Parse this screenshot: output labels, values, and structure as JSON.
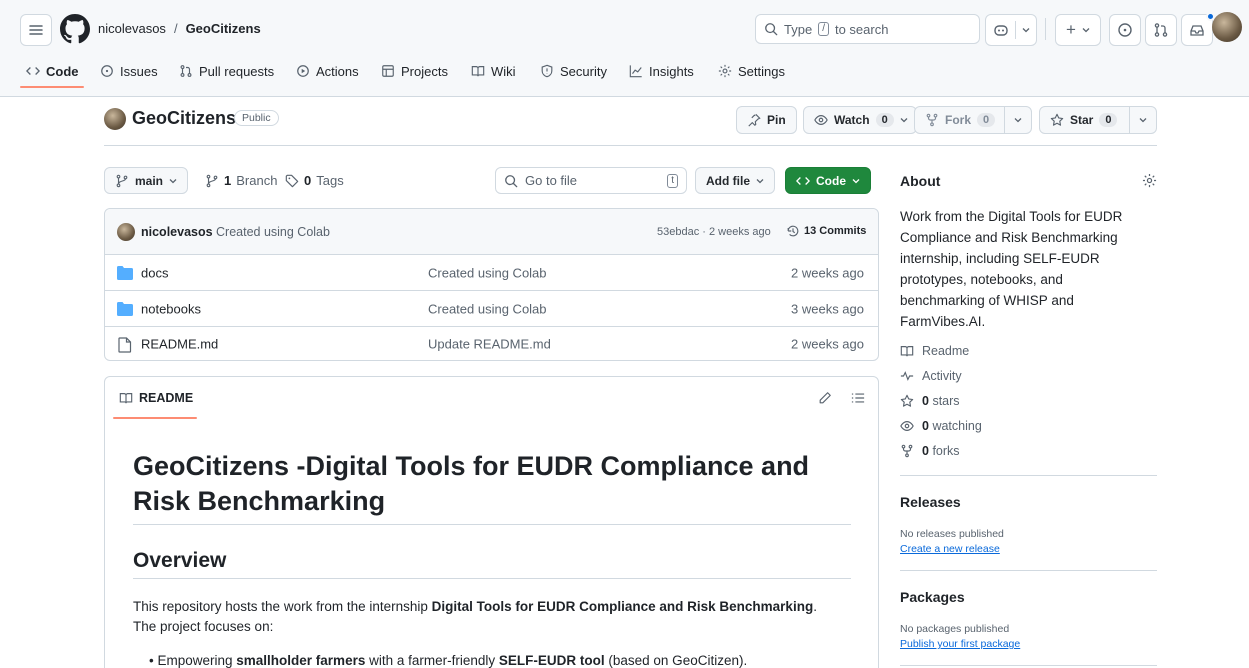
{
  "header": {
    "owner": "nicolevasos",
    "separator": "/",
    "repo": "GeoCitizens",
    "search_prefix": "Type",
    "search_key": "/",
    "search_suffix": "to search",
    "plus_label": "+"
  },
  "tabs": [
    {
      "label": "Code",
      "icon": "code-icon"
    },
    {
      "label": "Issues",
      "icon": "issue-icon"
    },
    {
      "label": "Pull requests",
      "icon": "pull-request-icon"
    },
    {
      "label": "Actions",
      "icon": "play-icon"
    },
    {
      "label": "Projects",
      "icon": "table-icon"
    },
    {
      "label": "Wiki",
      "icon": "book-icon"
    },
    {
      "label": "Security",
      "icon": "shield-icon"
    },
    {
      "label": "Insights",
      "icon": "graph-icon"
    },
    {
      "label": "Settings",
      "icon": "gear-icon"
    }
  ],
  "repo_head": {
    "name": "GeoCitizens",
    "visibility": "Public",
    "pin_label": "Pin",
    "watch_label": "Watch",
    "watch_count": "0",
    "fork_label": "Fork",
    "fork_count": "0",
    "star_label": "Star",
    "star_count": "0"
  },
  "toolbar": {
    "branch": "main",
    "branch_count": "1",
    "branch_word": "Branch",
    "tag_count": "0",
    "tag_word": "Tags",
    "goto_placeholder": "Go to file",
    "goto_key": "t",
    "add_file": "Add file",
    "code": "Code"
  },
  "commit": {
    "author": "nicolevasos",
    "message": "Created using Colab",
    "hash_time": "53ebdac · 2 weeks ago",
    "commits": "13 Commits"
  },
  "files": [
    {
      "name": "docs",
      "type": "folder",
      "message": "Created using Colab",
      "time": "2 weeks ago"
    },
    {
      "name": "notebooks",
      "type": "folder",
      "message": "Created using Colab",
      "time": "3 weeks ago"
    },
    {
      "name": "README.md",
      "type": "file",
      "message": "Update README.md",
      "time": "2 weeks ago"
    }
  ],
  "readme": {
    "tab": "README",
    "title": "GeoCitizens -Digital Tools for EUDR Compliance and Risk Benchmarking",
    "overview": "Overview",
    "p1_pre": "This repository hosts the work from the internship ",
    "p1_bold": "Digital Tools for EUDR Compliance and Risk Benchmarking",
    "p1_post": ".",
    "p2": "The project focuses on:",
    "bullet_pre": "Empowering ",
    "bullet_b1": "smallholder farmers",
    "bullet_mid": " with a farmer-friendly ",
    "bullet_b2": "SELF-EUDR tool",
    "bullet_post": " (based on GeoCitizen)."
  },
  "about": {
    "title": "About",
    "description": "Work from the Digital Tools for EUDR Compliance and Risk Benchmarking internship, including SELF-EUDR prototypes, notebooks, and benchmarking of WHISP and FarmVibes.AI.",
    "readme": "Readme",
    "activity": "Activity",
    "stars_count": "0",
    "stars_word": "stars",
    "watching_count": "0",
    "watching_word": "watching",
    "forks_count": "0",
    "forks_word": "forks"
  },
  "releases": {
    "title": "Releases",
    "none": "No releases published",
    "link": "Create a new release"
  },
  "packages": {
    "title": "Packages",
    "none": "No packages published",
    "link": "Publish your first package"
  },
  "colors": {
    "accent_green": "#1f883d",
    "tab_underline": "#fd8c73",
    "folder": "#54aeff",
    "link": "#0969da"
  }
}
